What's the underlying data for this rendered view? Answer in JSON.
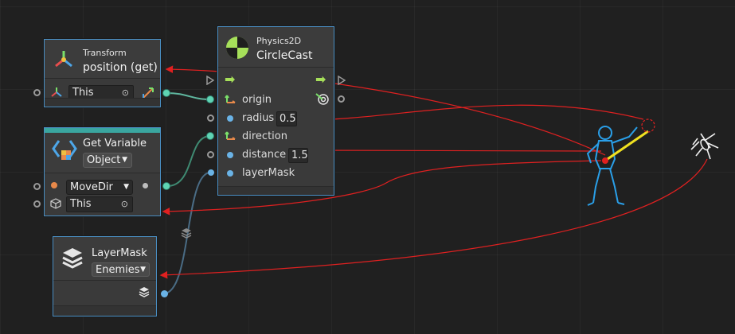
{
  "transform_node": {
    "subtitle": "Transform",
    "title": "position (get)",
    "target": "This"
  },
  "getvar_node": {
    "title": "Get Variable",
    "kind": "Object",
    "variable": "MoveDir",
    "target": "This"
  },
  "circlecast_node": {
    "subtitle": "Physics2D",
    "title": "CircleCast",
    "inputs": [
      {
        "label": "origin",
        "value": ""
      },
      {
        "label": "radius",
        "value": "0.5"
      },
      {
        "label": "direction",
        "value": ""
      },
      {
        "label": "distance",
        "value": "1.5"
      },
      {
        "label": "layerMask",
        "value": ""
      }
    ]
  },
  "layermask_node": {
    "title": "LayerMask",
    "value": "Enemies"
  },
  "colors": {
    "node_border": "#4a8fc4",
    "annotation": "#e02020",
    "port_teal": "#5fd4b4",
    "port_blue": "#6ab3e6",
    "flow_green": "#a6e05a"
  }
}
